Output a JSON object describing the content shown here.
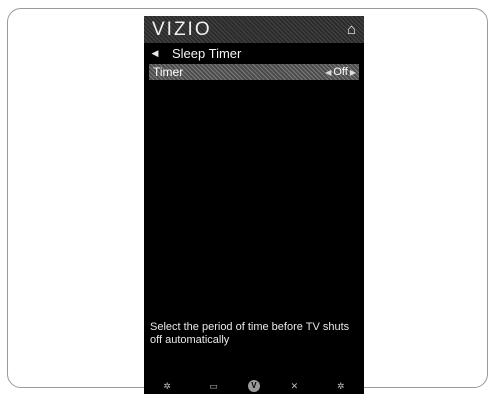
{
  "brand": {
    "logo": "VIZIO"
  },
  "header": {
    "title": "Sleep Timer"
  },
  "menu": {
    "items": [
      {
        "label": "Timer",
        "value": "Off"
      }
    ]
  },
  "help_text": "Select the period of time before TV shuts off automatically",
  "icons": {
    "home": "home-icon",
    "back": "back-arrow-icon",
    "left": "left-arrow-icon",
    "right": "right-arrow-icon"
  },
  "nav_buttons": [
    {
      "icon": "settings-icon",
      "glyph": "✲"
    },
    {
      "icon": "input-icon",
      "glyph": "▭"
    },
    {
      "icon": "vizio-v-icon",
      "glyph": "V"
    },
    {
      "icon": "close-icon",
      "glyph": "✕"
    },
    {
      "icon": "gear-icon",
      "glyph": "✲"
    }
  ],
  "colors": {
    "screen_bg": "#000000",
    "highlight": "#6a6a6a",
    "text": "#ffffff"
  }
}
